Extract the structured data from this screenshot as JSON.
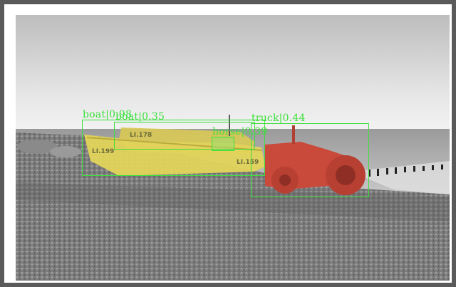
{
  "image": {
    "hull_markings": [
      "LI.199",
      "LI.178",
      "LI.159"
    ]
  },
  "detections": [
    {
      "label": "boat",
      "score": "0.98",
      "color": "#3be03b"
    },
    {
      "label": "boat",
      "score": "0.35",
      "color": "#3be03b"
    },
    {
      "label": "horse",
      "score": "0.39",
      "color": "#3be03b"
    },
    {
      "label": "truck",
      "score": "0.44",
      "color": "#3be03b"
    }
  ],
  "colors": {
    "box": "#3be03b",
    "boat_mask": "#e2d45a",
    "truck_mask": "#c9493a"
  }
}
